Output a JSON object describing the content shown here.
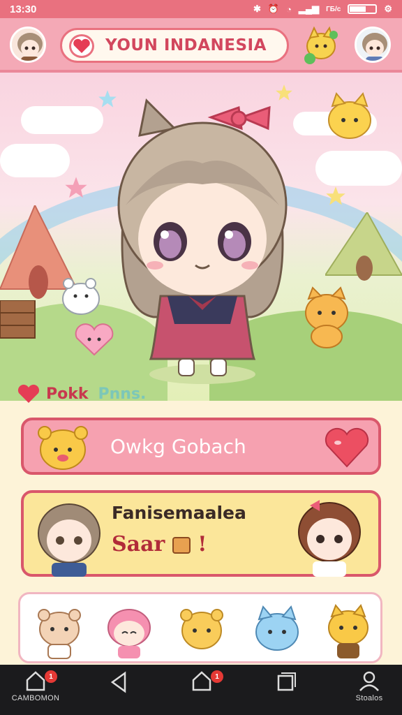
{
  "status": {
    "time": "13:30",
    "battery_icon": "battery-icon",
    "signal_icon": "signal-icon",
    "wifi_icon": "wifi-icon",
    "net": "ГБ/с"
  },
  "header": {
    "title": "YOUN INDANESIA"
  },
  "section": {
    "label1": "Pokk",
    "label2": "Pnns."
  },
  "card_pink": {
    "label": "Owkg Gobach"
  },
  "card_yellow": {
    "title": "Fanisemaalea",
    "sub": "Saar",
    "exclaim": "!"
  },
  "nav": {
    "items": [
      {
        "label": "CAMBOMON",
        "badge": "1",
        "icon": "home-icon"
      },
      {
        "label": "",
        "icon": "back-icon"
      },
      {
        "label": "",
        "badge": "1",
        "icon": "home-icon"
      },
      {
        "label": "",
        "icon": "recents-icon"
      },
      {
        "label": "Stoalos",
        "icon": "profile-icon"
      }
    ]
  },
  "colors": {
    "accent": "#e9717f",
    "pink_card": "#f6a1b0",
    "yellow_card": "#fbe69a",
    "border": "#d9576b"
  }
}
